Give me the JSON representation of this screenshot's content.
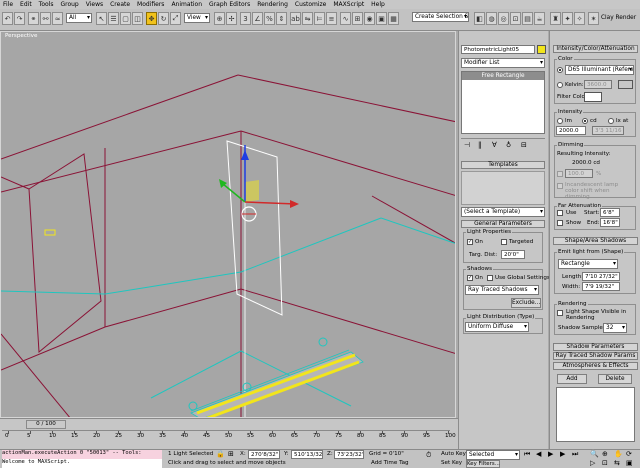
{
  "menu": [
    "File",
    "Edit",
    "Tools",
    "Group",
    "Views",
    "Create",
    "Modifiers",
    "Animation",
    "Graph Editors",
    "Rendering",
    "Customize",
    "MAXScript",
    "Help"
  ],
  "toolbar": {
    "filter_value": "All",
    "ref_coord_value": "View",
    "selection_set_placeholder": "Create Selection Set",
    "clay_render_label": "Clay Render"
  },
  "viewport": {
    "label": "Perspective"
  },
  "modify_panel": {
    "object_name": "PhotometricLight05",
    "object_color": "#f2e51b",
    "modifier_list_value": "Modifier List",
    "stack_items": [
      "Free Rectangle"
    ],
    "templates": {
      "header": "Templates",
      "select_value": "(Select a Template)"
    },
    "general": {
      "header": "General Parameters",
      "light_properties_label": "Light Properties",
      "on_label": "On",
      "targeted_label": "Targeted",
      "targ_dist_label": "Targ. Dist:",
      "targ_dist_value": "20'0\"",
      "shadows_label": "Shadows",
      "shadows_on_label": "On",
      "use_global_label": "Use Global Settings",
      "shadow_type_value": "Ray Traced Shadows",
      "exclude_label": "Exclude..."
    },
    "light_distribution": {
      "header": "Light Distribution (Type)",
      "type_value": "Uniform Diffuse"
    }
  },
  "right_panel": {
    "intensity_header": "Intensity/Color/Attenuation",
    "color_label": "Color",
    "color_preset_value": "D65 Illuminant (Refere",
    "kelvin_label": "Kelvin:",
    "kelvin_value": "3600.0",
    "filter_color_label": "Filter Color:",
    "intensity_label": "Intensity",
    "lm_label": "lm",
    "cd_label": "cd",
    "lx_label": "lx at",
    "intensity_value": "2000.0",
    "lx_value": "3'3 11/16",
    "dimming_label": "Dimming",
    "resulting_label": "Resulting Intensity:",
    "resulting_value": "2000.0 cd",
    "dim_percent_value": "100.0",
    "percent_sign": "%",
    "incandescent_label": "Incandescent lamp color shift when dimming",
    "far_att_label": "Far Attenuation",
    "use_label": "Use",
    "start_label": "Start:",
    "start_value": "6'8\"",
    "show_label": "Show",
    "end_label": "End:",
    "end_value": "16'8\"",
    "shape_header": "Shape/Area Shadows",
    "emit_label": "Emit light from (Shape)",
    "shape_value": "Rectangle",
    "length_label": "Length:",
    "length_value": "7'10 27/32\"",
    "width_label": "Width:",
    "width_value": "7'9 19/32\"",
    "rendering_label": "Rendering",
    "light_shape_visible_label": "Light Shape Visible in Rendering",
    "shadow_samples_label": "Shadow Samples:",
    "shadow_samples_value": "32",
    "shadow_params_header": "Shadow Parameters",
    "ray_params_header": "Ray Traced Shadow Params",
    "atmos_header": "Atmospheres & Effects",
    "add_label": "Add",
    "delete_label": "Delete"
  },
  "timeline": {
    "frame_counter": "0 / 100",
    "ticks": [
      "0",
      "5",
      "10",
      "15",
      "20",
      "25",
      "30",
      "35",
      "40",
      "45",
      "50",
      "55",
      "60",
      "65",
      "70",
      "75",
      "80",
      "85",
      "90",
      "95",
      "100"
    ]
  },
  "status": {
    "maxscript_line1": "actionMan.executeAction 0 \"50013\"  -- Tools:",
    "maxscript_line2": "Welcome to MAXScript.",
    "selected_text": "1 Light Selected",
    "prompt_text": "Click and drag to select and move objects",
    "x_label": "X:",
    "x_value": "270'8/32\"",
    "y_label": "Y:",
    "y_value": "510'13/32",
    "z_label": "Z:",
    "z_value": "73'23/32\"",
    "grid_text": "Grid = 0'10\"",
    "add_time_tag": "Add Time Tag",
    "auto_key": "Auto Key",
    "set_key": "Set Key",
    "selected_value": "Selected",
    "key_filters": "Key Filters..."
  }
}
